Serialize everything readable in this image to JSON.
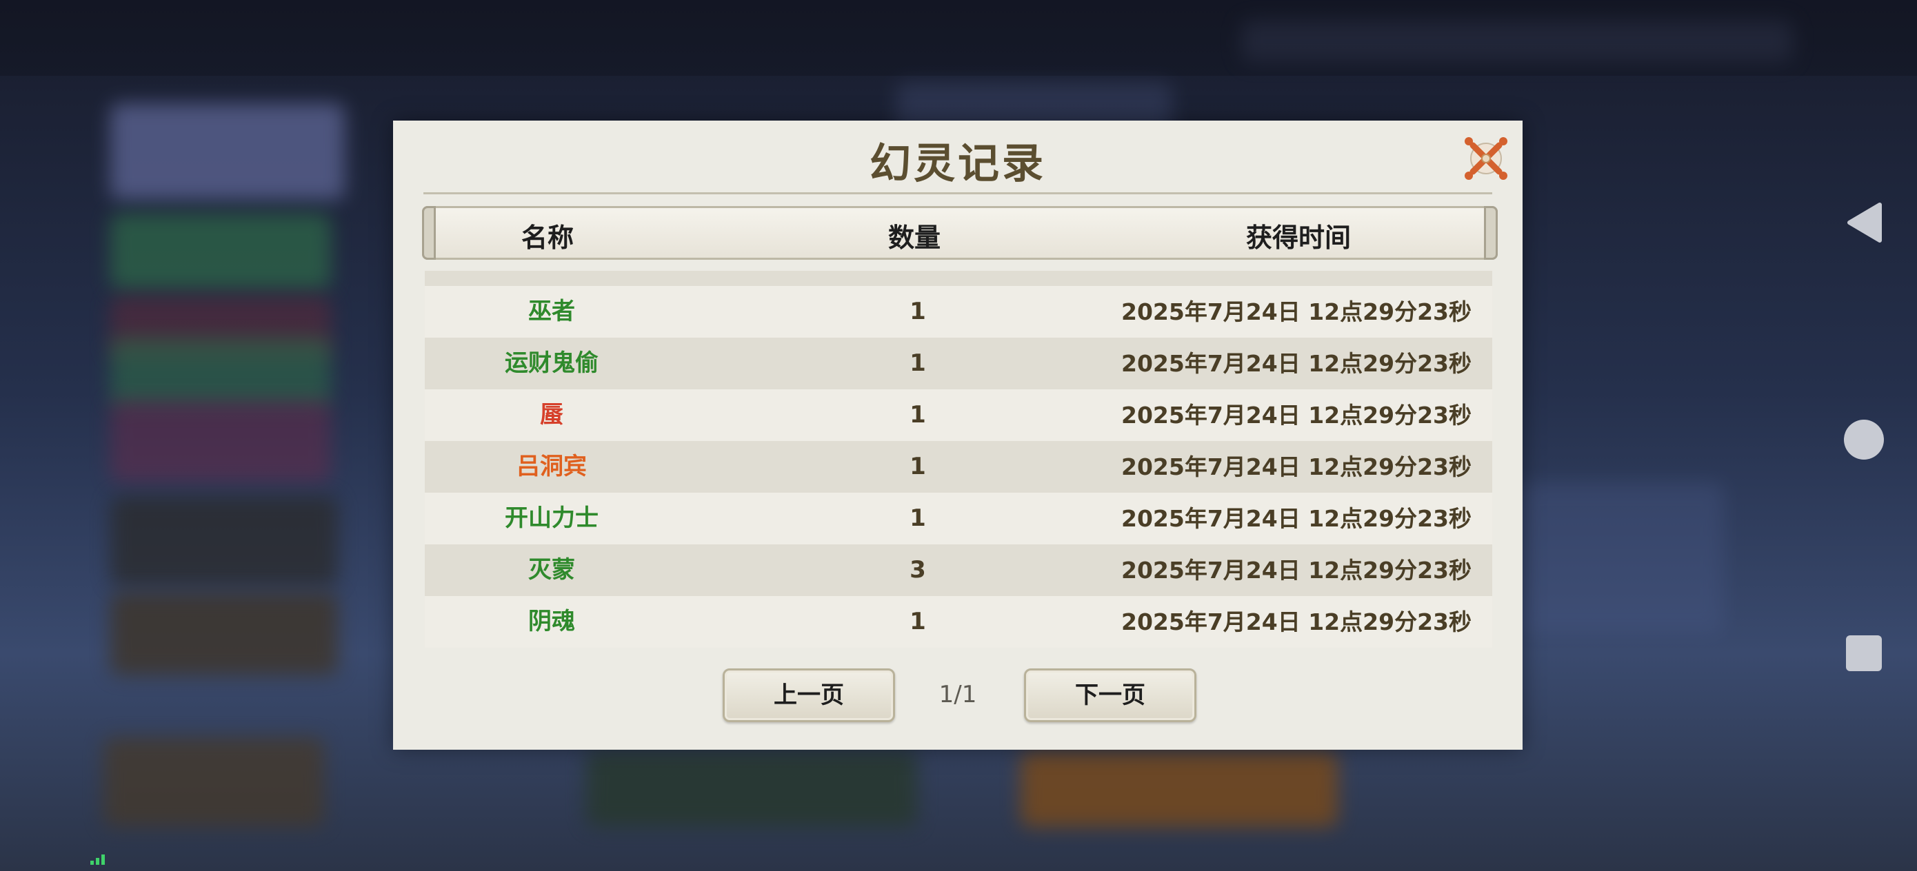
{
  "dialog": {
    "title": "幻灵记录",
    "columns": [
      "名称",
      "数量",
      "获得时间"
    ],
    "rows": [
      {
        "name": "巫者",
        "qty": "1",
        "time": "2025年7月24日  12点29分23秒",
        "color": "#2f8a2c"
      },
      {
        "name": "运财鬼偷",
        "qty": "1",
        "time": "2025年7月24日  12点29分23秒",
        "color": "#2f8a2c"
      },
      {
        "name": "蜃",
        "qty": "1",
        "time": "2025年7月24日  12点29分23秒",
        "color": "#d6402a"
      },
      {
        "name": "吕洞宾",
        "qty": "1",
        "time": "2025年7月24日  12点29分23秒",
        "color": "#e0601e"
      },
      {
        "name": "开山力士",
        "qty": "1",
        "time": "2025年7月24日  12点29分23秒",
        "color": "#2f8a2c"
      },
      {
        "name": "灭蒙",
        "qty": "3",
        "time": "2025年7月24日  12点29分23秒",
        "color": "#2f8a2c"
      },
      {
        "name": "阴魂",
        "qty": "1",
        "time": "2025年7月24日  12点29分23秒",
        "color": "#2f8a2c"
      }
    ],
    "pager": {
      "prev_label": "上一页",
      "next_label": "下一页",
      "page": "1/1"
    }
  },
  "colors": {
    "panel": "#ecebe4",
    "title": "#5b4e30",
    "close": "#d4612e",
    "green_name": "#2f8a2c"
  },
  "icons": {
    "close": "close-icon",
    "back": "back-triangle-icon",
    "home": "home-circle-icon",
    "recents": "recents-square-icon",
    "signal": "signal-icon"
  }
}
